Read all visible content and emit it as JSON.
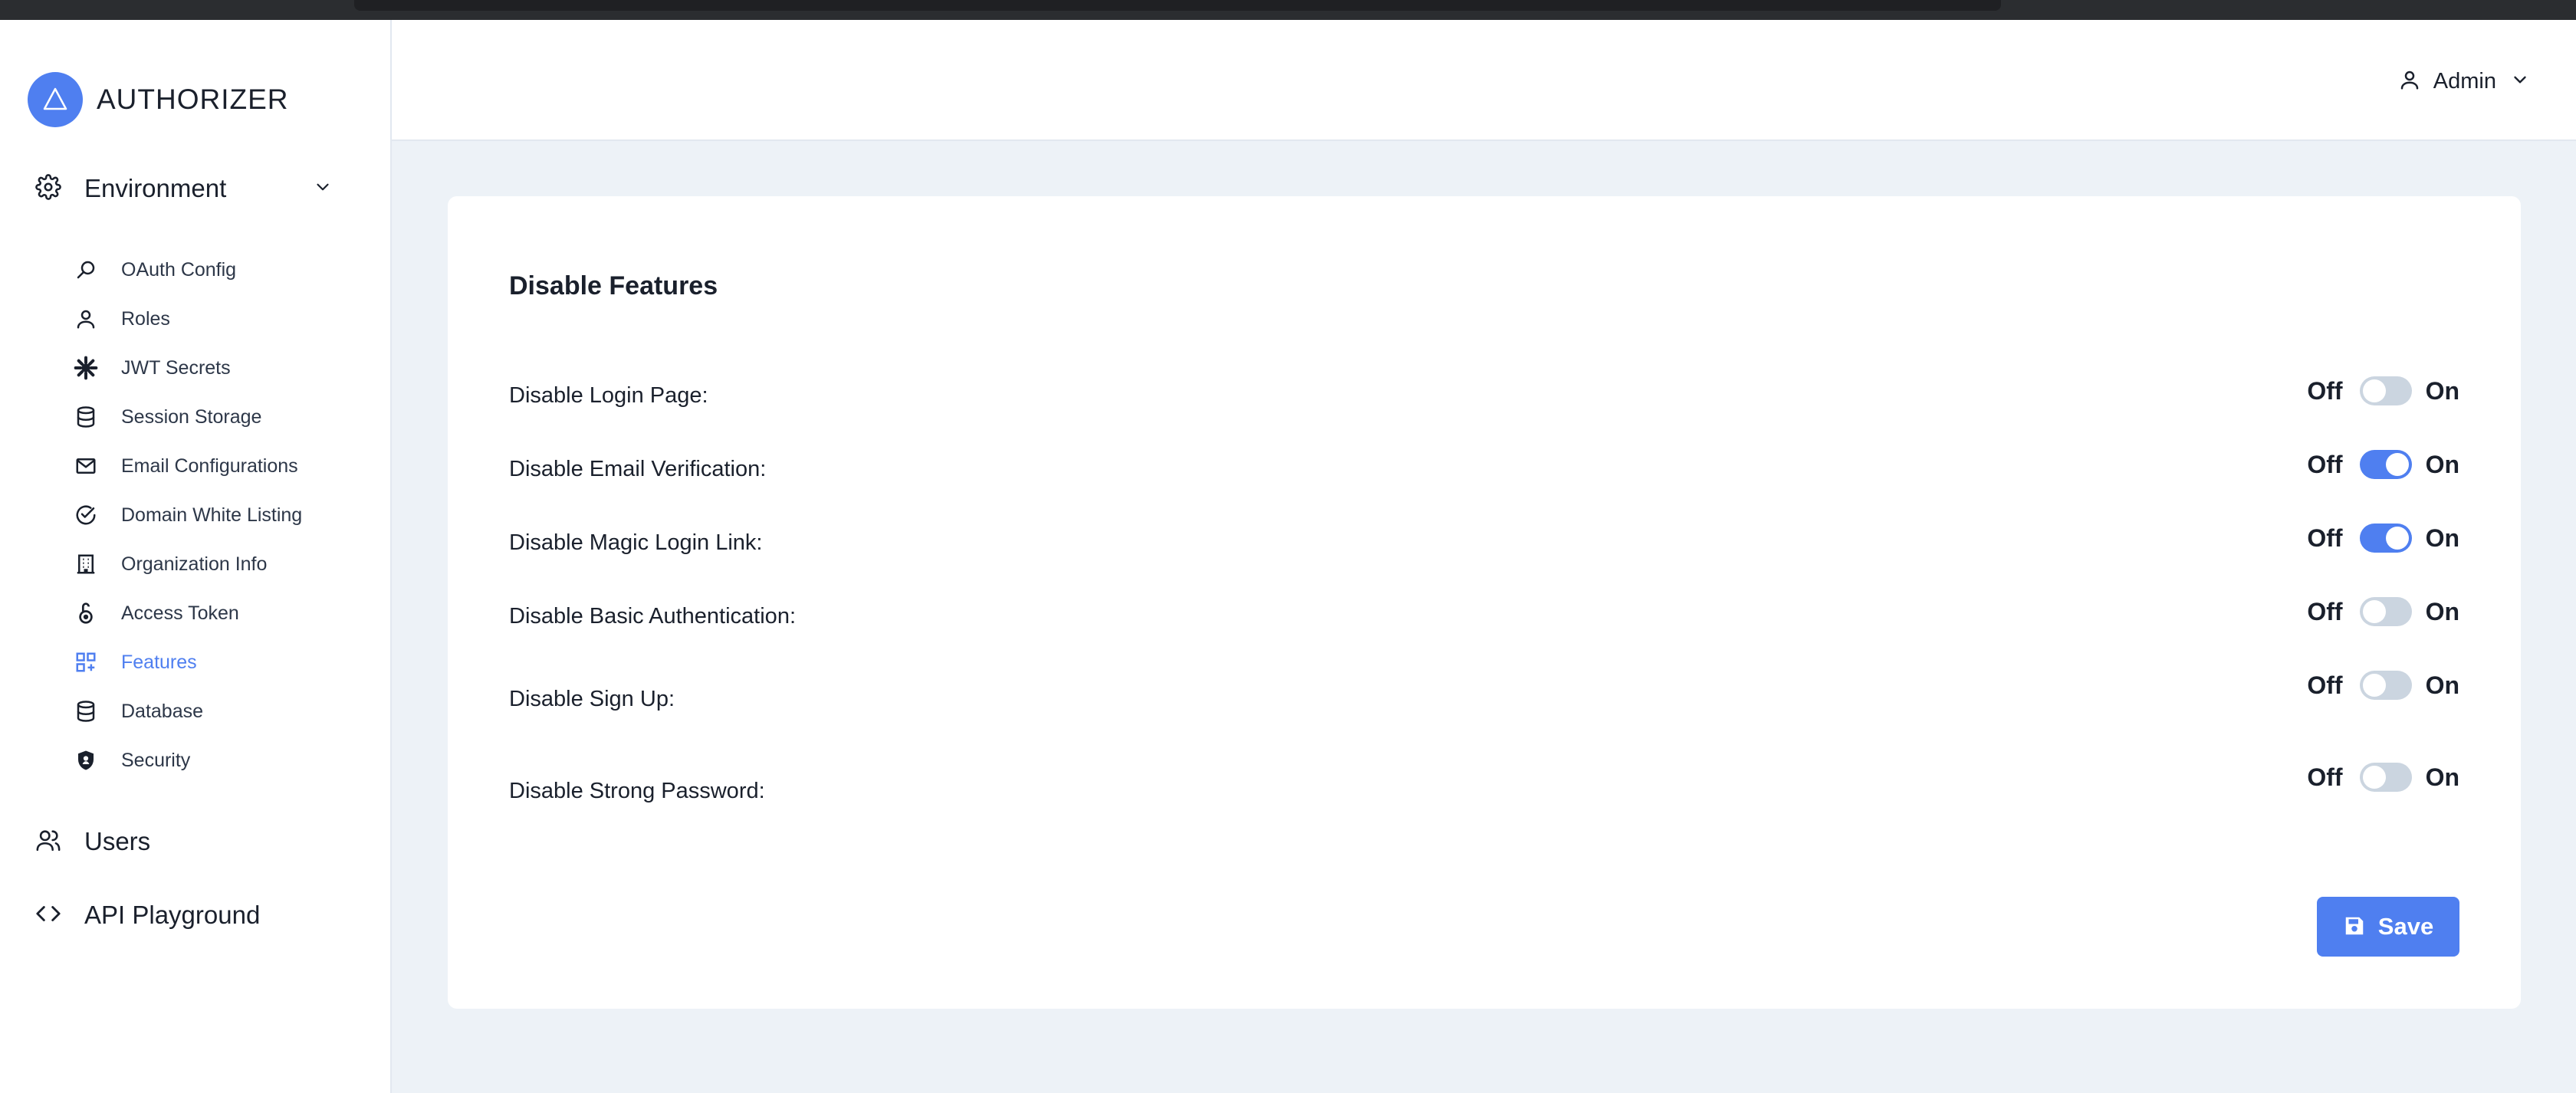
{
  "brand": {
    "name": "AUTHORIZER"
  },
  "sidebar": {
    "environment_label": "Environment",
    "items": [
      {
        "label": "OAuth Config",
        "icon": "search-icon"
      },
      {
        "label": "Roles",
        "icon": "user-icon"
      },
      {
        "label": "JWT Secrets",
        "icon": "asterisk-icon"
      },
      {
        "label": "Session Storage",
        "icon": "database-icon"
      },
      {
        "label": "Email Configurations",
        "icon": "mail-icon"
      },
      {
        "label": "Domain White Listing",
        "icon": "check-circle-icon"
      },
      {
        "label": "Organization Info",
        "icon": "building-icon"
      },
      {
        "label": "Access Token",
        "icon": "key-icon"
      },
      {
        "label": "Features",
        "icon": "grid-plus-icon",
        "active": true
      },
      {
        "label": "Database",
        "icon": "database-icon"
      },
      {
        "label": "Security",
        "icon": "shield-icon"
      }
    ],
    "users_label": "Users",
    "playground_label": "API Playground"
  },
  "header": {
    "user_label": "Admin"
  },
  "features": {
    "title": "Disable Features",
    "off_label": "Off",
    "on_label": "On",
    "rows": [
      {
        "label": "Disable Login Page:",
        "on": false
      },
      {
        "label": "Disable Email Verification:",
        "on": true
      },
      {
        "label": "Disable Magic Login Link:",
        "on": true
      },
      {
        "label": "Disable Basic Authentication:",
        "on": false
      },
      {
        "label": "Disable Sign Up:",
        "on": false
      },
      {
        "label": "Disable Strong Password:",
        "on": false
      }
    ],
    "save_label": "Save"
  },
  "colors": {
    "accent": "#4f7ff0",
    "background": "#edf2f7",
    "toggle_off": "#cbd5e0"
  }
}
